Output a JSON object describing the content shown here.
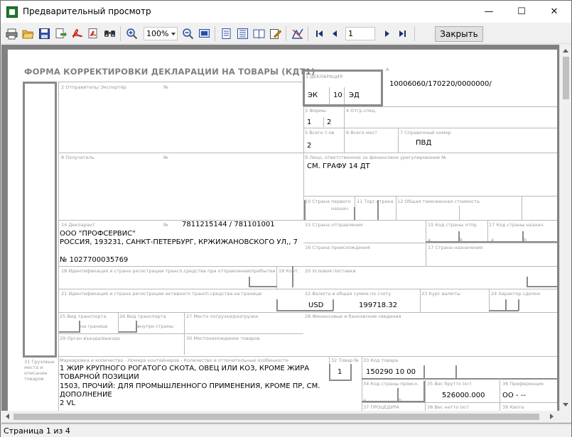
{
  "window": {
    "title": "Предварительный просмотр",
    "minimize_glyph": "—",
    "maximize_glyph": "☐",
    "close_glyph": "✕"
  },
  "toolbar": {
    "zoom_value": "100%",
    "page_value": "1",
    "close_label": "Закрыть",
    "icons": [
      "print-icon",
      "open-icon",
      "save-icon",
      "export-icon",
      "pdf-icon",
      "export-pdf-icon",
      "find-icon",
      "zoom-in-icon",
      "zoom-out-icon",
      "page-view-icon",
      "single-page-icon",
      "multi-page-icon",
      "book-icon",
      "edit-icon",
      "design-icon",
      "first-page-icon",
      "prev-page-icon",
      "next-page-icon",
      "last-page-icon"
    ]
  },
  "status": {
    "text": "Страница 1 из 4"
  },
  "form": {
    "title": "ФОРМА КОРРЕКТИРОВКИ ДЕКЛАРАЦИИ НА ТОВАРЫ (КДТ1)",
    "a_label": "A",
    "decl_number": "10006060/170220/0000000/",
    "box1": {
      "label": "1 ДЕКЛАРАЦИЯ",
      "v1": "ЭК",
      "v2": "10",
      "v3": "ЭД"
    },
    "box2": {
      "label": "2 Отправитель/ Экспортёр",
      "no": "№"
    },
    "box3": {
      "label": "3 Формы",
      "v1": "1",
      "v2": "2"
    },
    "box4": {
      "label": "4 Отгр.спец."
    },
    "box5": {
      "label": "5 Всего т-ов",
      "value": "2"
    },
    "box6": {
      "label": "6 Всего мест"
    },
    "box7": {
      "label": "7 Справочный номер",
      "value": "ПВД"
    },
    "box8": {
      "label": "8 Получатель",
      "no": "№"
    },
    "box9": {
      "label": "9 Лицо, ответственное за финансовое урегулирование №",
      "value": "СМ. ГРАФУ 14 ДТ"
    },
    "box10": {
      "label1": "10 Страна первого",
      "label2": "назнач."
    },
    "box11": {
      "label": "11 Торг.страна"
    },
    "box12": {
      "label": "12 Общая таможенная стоимость"
    },
    "box14": {
      "label": "14 Декларант",
      "no": "№",
      "inn": "7811215144 / 781101001",
      "name": "ООО \"ПРОФСЕРВИС\"",
      "address": "РОССИЯ, 193231, САНКТ-ПЕТЕРБУРГ, КРЖИЖАНОВСКОГО УЛ,, 7",
      "ogrn": "№ 1027700035769"
    },
    "box15": {
      "label": "15 Страна отправления"
    },
    "box15a": {
      "label": "15 Код страны отпр.",
      "a": "a",
      "b": "b"
    },
    "box17a": {
      "label": "17 Код страны назнач.",
      "a": "a",
      "b": "b"
    },
    "box16": {
      "label": "16 Страна происхождения"
    },
    "box17": {
      "label": "17 Страна назначения"
    },
    "box18": {
      "label": "18 Идентификация и страна регистрации трансп.средства при отправлении/прибытии"
    },
    "box19": {
      "label": "19 Конт."
    },
    "box20": {
      "label": "20 Условия поставки"
    },
    "box21": {
      "label": "21 Идентификация и страна регистрации активного трансп.средства на границе"
    },
    "box22": {
      "label": "22 Валюта и общая сумма по счету",
      "currency": "USD",
      "amount": "199718.32"
    },
    "box23": {
      "label": "23 Курс валюты"
    },
    "box24": {
      "label": "24 Характер сделки"
    },
    "box25": {
      "label1": "25 Вид транспорта",
      "label2": "на границе"
    },
    "box26": {
      "label1": "26 Вид транспорта",
      "label2": "внутри страны"
    },
    "box27": {
      "label": "27 Место погрузки/разгрузки"
    },
    "box28": {
      "label": "28 Финансовые и банковские сведения"
    },
    "box29": {
      "label": "29 Орган въезда/выезда"
    },
    "box30": {
      "label": "30 Местонахождение товаров"
    },
    "box31": {
      "label_lines": [
        "31 Грузовые",
        "места и",
        "описание",
        "товаров"
      ],
      "header": "Маркировка и количество - Номера контейнеров - Количество и отличительные особенности",
      "line1": "1 ЖИР КРУПНОГО РОГАТОГО СКОТА, ОВЕЦ ИЛИ КОЗ, КРОМЕ ЖИРА",
      "line2": "ТОВАРНОЙ ПОЗИЦИИ",
      "line3": "1503, ПРОЧИЙ: ДЛЯ ПРОМЫШЛЕННОГО ПРИМЕНЕНИЯ, КРОМЕ ПР, СМ.",
      "line4": "ДОПОЛНЕНИЕ",
      "line5": "2  VL"
    },
    "box32": {
      "label": "32 Товар №",
      "value": "1"
    },
    "box33": {
      "label": "33 Код товара",
      "value": "150290  10  00"
    },
    "box34": {
      "label": "34 Код страны происх.",
      "a": "a",
      "b": "b"
    },
    "box35": {
      "label": "35 Вес брутто (кг)",
      "value": "526000.000"
    },
    "box36": {
      "label": "36 Преференция",
      "value": "ОО     -   --"
    },
    "box37": {
      "label": "37 ПРОЦЕДУРА"
    },
    "box38": {
      "label": "38 Вес нетто (кг)"
    },
    "box39": {
      "label": "39 Квота"
    }
  }
}
